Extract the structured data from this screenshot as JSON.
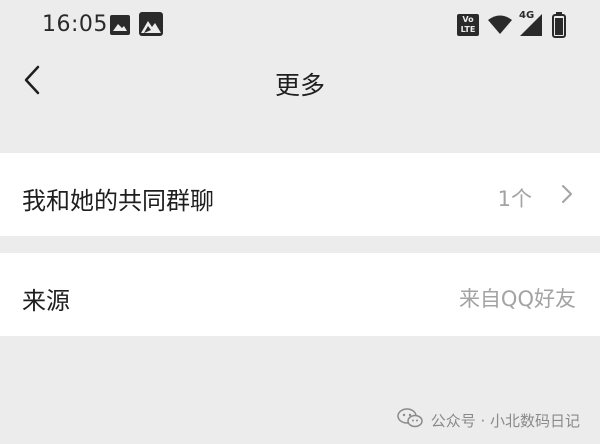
{
  "status_bar": {
    "time": "16:05",
    "volte_badge_top": "Vo",
    "volte_badge_bottom": "LTE",
    "network_type": "4G",
    "icons": [
      "image-icon",
      "gallery-icon",
      "volte-icon",
      "wifi-icon",
      "signal-icon",
      "battery-icon"
    ]
  },
  "header": {
    "title": "更多",
    "back_icon": "chevron-left-icon"
  },
  "rows": [
    {
      "label": "我和她的共同群聊",
      "value": "1个",
      "has_chevron": true
    },
    {
      "label": "来源",
      "value": "来自QQ好友",
      "has_chevron": false
    }
  ],
  "watermark": {
    "text": "公众号 · 小北数码日记",
    "icon": "wechat-icon"
  },
  "colors": {
    "background": "#ececec",
    "row_background": "#ffffff",
    "primary_text": "#1e1e1e",
    "secondary_text": "#a3a3a3"
  }
}
